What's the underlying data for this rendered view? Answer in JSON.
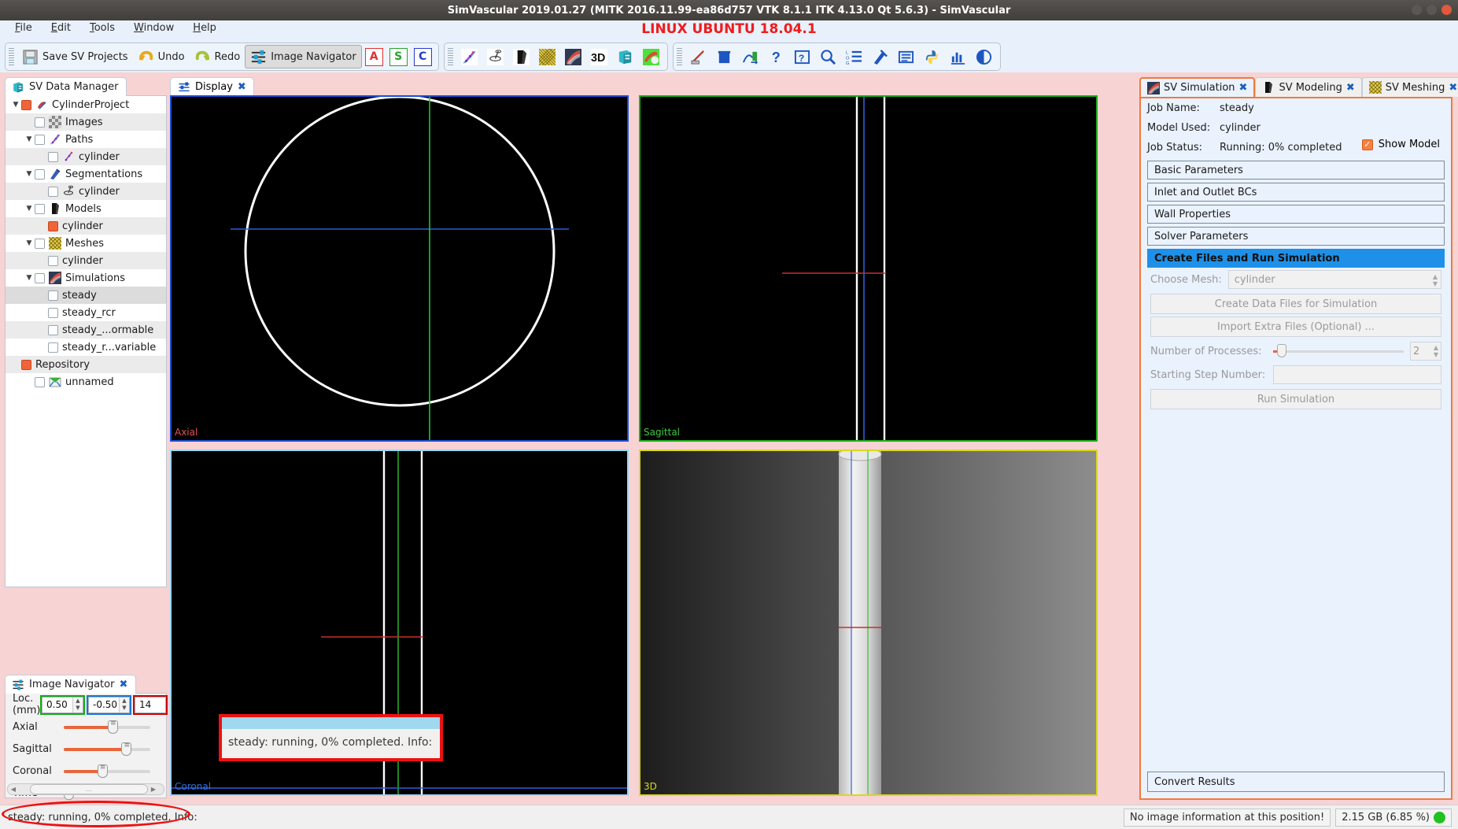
{
  "window": {
    "title": "SimVascular 2019.01.27 (MITK 2016.11.99-ea86d757 VTK 8.1.1 ITK 4.13.0 Qt 5.6.3) - SimVascular",
    "banner": "LINUX UBUNTU 18.04.1"
  },
  "menu": [
    {
      "label": "File"
    },
    {
      "label": "Edit"
    },
    {
      "label": "Tools"
    },
    {
      "label": "Window"
    },
    {
      "label": "Help"
    }
  ],
  "toolbar": {
    "save_label": "Save SV Projects",
    "undo_label": "Undo",
    "redo_label": "Redo",
    "image_navigator_label": "Image Navigator",
    "letter_a": "A",
    "letter_s": "S",
    "letter_c": "C",
    "icons_group2": [
      "paths-icon",
      "segmentations-icon",
      "models-icon",
      "meshes-icon",
      "simulations-icon",
      "3d-icon",
      "repository-icon",
      "svfsi-icon"
    ],
    "icons_group3": [
      "pencil-ruler-icon",
      "trashcan-icon",
      "measurement-icon",
      "help-question-icon",
      "about-icon",
      "magnifier-icon",
      "log-list-icon",
      "preferences-icon",
      "text-list-icon",
      "python-console-icon",
      "chart-icon",
      "visibility-eye-icon"
    ]
  },
  "data_manager": {
    "tab_label": "SV Data Manager",
    "tab_icon": "datamanager-icon",
    "rows": [
      {
        "label": "CylinderProject",
        "depth": 0,
        "arrow": "▼",
        "checkbox": "orange",
        "icon": "simvascular-logo-icon",
        "alt": false,
        "selected": false
      },
      {
        "label": "Images",
        "depth": 1,
        "arrow": "",
        "checkbox": "empty",
        "icon": "images-icon",
        "alt": true,
        "selected": false
      },
      {
        "label": "Paths",
        "depth": 1,
        "arrow": "▼",
        "checkbox": "empty",
        "icon": "paths-icon",
        "alt": false,
        "selected": false
      },
      {
        "label": "cylinder",
        "depth": 2,
        "arrow": "",
        "checkbox": "empty",
        "icon": "path-item-icon",
        "alt": true,
        "selected": false
      },
      {
        "label": "Segmentations",
        "depth": 1,
        "arrow": "▼",
        "checkbox": "empty",
        "icon": "segmentations-icon",
        "alt": false,
        "selected": false
      },
      {
        "label": "cylinder",
        "depth": 2,
        "arrow": "",
        "checkbox": "empty",
        "icon": "segmentation-item-icon",
        "alt": true,
        "selected": false
      },
      {
        "label": "Models",
        "depth": 1,
        "arrow": "▼",
        "checkbox": "empty",
        "icon": "models-icon",
        "alt": false,
        "selected": false
      },
      {
        "label": "cylinder",
        "depth": 2,
        "arrow": "",
        "checkbox": "orange",
        "icon": "",
        "alt": true,
        "selected": false
      },
      {
        "label": "Meshes",
        "depth": 1,
        "arrow": "▼",
        "checkbox": "empty",
        "icon": "meshes-icon",
        "alt": false,
        "selected": false
      },
      {
        "label": "cylinder",
        "depth": 2,
        "arrow": "",
        "checkbox": "empty",
        "icon": "",
        "alt": true,
        "selected": false
      },
      {
        "label": "Simulations",
        "depth": 1,
        "arrow": "▼",
        "checkbox": "empty",
        "icon": "simulations-icon",
        "alt": false,
        "selected": false
      },
      {
        "label": "steady",
        "depth": 2,
        "arrow": "",
        "checkbox": "empty",
        "icon": "",
        "alt": false,
        "selected": true
      },
      {
        "label": "steady_rcr",
        "depth": 2,
        "arrow": "",
        "checkbox": "empty",
        "icon": "",
        "alt": false,
        "selected": false
      },
      {
        "label": "steady_...ormable",
        "depth": 2,
        "arrow": "",
        "checkbox": "empty",
        "icon": "",
        "alt": true,
        "selected": false
      },
      {
        "label": "steady_r...variable",
        "depth": 2,
        "arrow": "",
        "checkbox": "empty",
        "icon": "",
        "alt": false,
        "selected": false
      },
      {
        "label": "Repository",
        "depth": 0,
        "arrow": "",
        "checkbox": "orange",
        "icon": "",
        "alt": true,
        "selected": false
      },
      {
        "label": "unnamed",
        "depth": 1,
        "arrow": "",
        "checkbox": "empty",
        "icon": "unnamed-icon",
        "alt": false,
        "selected": false
      }
    ]
  },
  "image_navigator": {
    "tab_label": "Image Navigator",
    "tab_icon": "sliders-icon",
    "loc_label": "Loc. (mm)",
    "loc_values": [
      "0.50",
      "-0.50",
      "14"
    ],
    "sliders": [
      {
        "label": "Axial",
        "percent": 55
      },
      {
        "label": "Sagittal",
        "percent": 72
      },
      {
        "label": "Coronal",
        "percent": 42
      },
      {
        "label": "Time",
        "percent": 0
      }
    ]
  },
  "display": {
    "tab_label": "Display",
    "tab_icon": "display-icon",
    "viewports": [
      {
        "name": "Axial",
        "label": "Axial"
      },
      {
        "name": "Sagittal",
        "label": "Sagittal"
      },
      {
        "name": "Coronal",
        "label": "Coronal"
      },
      {
        "name": "3D",
        "label": "3D"
      }
    ],
    "tooltip_text": "steady: running, 0% completed. Info:"
  },
  "right_panel": {
    "tabs": [
      {
        "label": "SV Simulation",
        "icon": "simulations-icon",
        "active": true
      },
      {
        "label": "SV Modeling",
        "icon": "models-icon",
        "active": false
      },
      {
        "label": "SV Meshing",
        "icon": "meshes-icon",
        "active": false
      }
    ],
    "job_name_label": "Job Name:",
    "job_name_value": "steady",
    "model_used_label": "Model Used:",
    "model_used_value": "cylinder",
    "job_status_label": "Job Status:",
    "job_status_value": "Running: 0% completed",
    "show_model_label": "Show Model",
    "sections": [
      {
        "label": "Basic Parameters",
        "active": false
      },
      {
        "label": "Inlet and Outlet BCs",
        "active": false
      },
      {
        "label": "Wall Properties",
        "active": false
      },
      {
        "label": "Solver Parameters",
        "active": false
      },
      {
        "label": "Create Files and Run Simulation",
        "active": true
      }
    ],
    "choose_mesh_label": "Choose Mesh:",
    "choose_mesh_value": "cylinder",
    "create_data_files_label": "Create Data Files for Simulation",
    "import_extra_files_label": "Import Extra Files (Optional) ...",
    "num_processes_label": "Number of Processes:",
    "num_processes_value": "2",
    "starting_step_label": "Starting Step Number:",
    "starting_step_value": "",
    "run_simulation_label": "Run Simulation",
    "convert_results_label": "Convert Results"
  },
  "statusbar": {
    "left_text": "steady: running, 0% completed. Info:",
    "no_image_info": "No image information at this position!",
    "memory": "2.15 GB (6.85 %)"
  },
  "colors": {
    "accent_orange": "#f07a40",
    "active_blue": "#1e90e8",
    "banner_red": "#ee1c1c",
    "panel_bg": "#eaf2fd",
    "dock_bg": "#f7d3d3"
  }
}
